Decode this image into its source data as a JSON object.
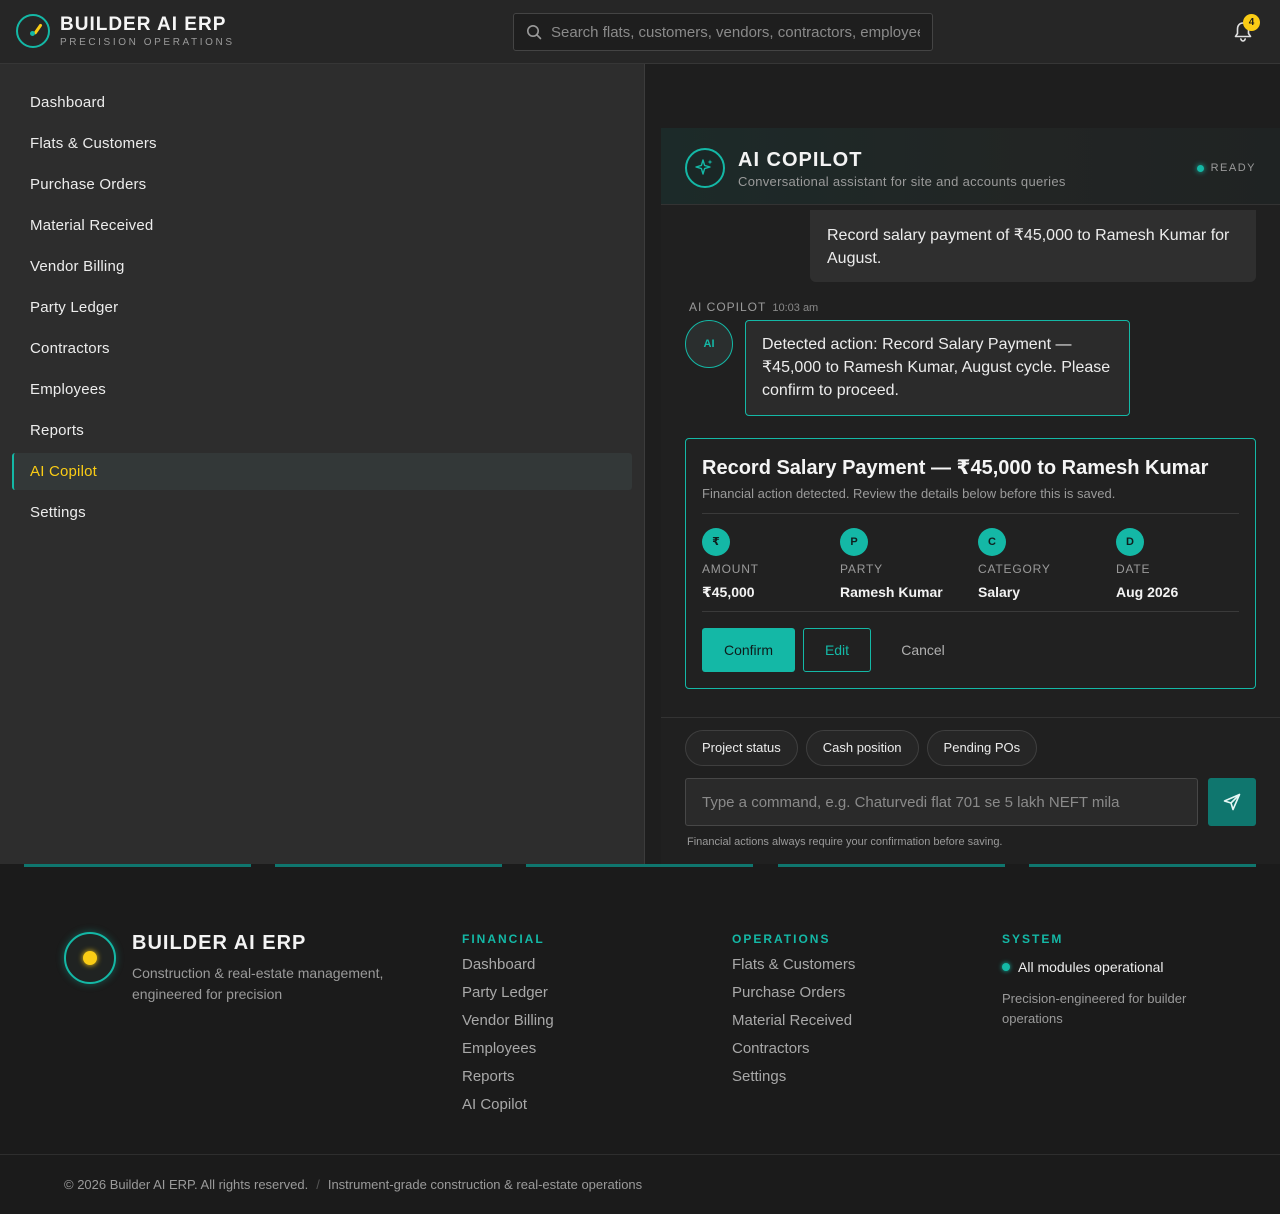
{
  "header": {
    "brand_title": "BUILDER AI ERP",
    "brand_subtitle": "PRECISION OPERATIONS",
    "search_placeholder": "Search flats, customers, vendors, contractors, employees",
    "notification_count": "4"
  },
  "sidebar": {
    "items": [
      {
        "label": "Dashboard"
      },
      {
        "label": "Flats & Customers"
      },
      {
        "label": "Purchase Orders"
      },
      {
        "label": "Material Received"
      },
      {
        "label": "Vendor Billing"
      },
      {
        "label": "Party Ledger"
      },
      {
        "label": "Contractors"
      },
      {
        "label": "Employees"
      },
      {
        "label": "Reports"
      },
      {
        "label": "AI Copilot",
        "active": true
      },
      {
        "label": "Settings"
      }
    ]
  },
  "copilot": {
    "title": "AI COPILOT",
    "subtitle": "Conversational assistant for site and accounts queries",
    "status": "READY",
    "user_message": "Record salary payment of ₹45,000 to Ramesh Kumar for August.",
    "ai_sender": "AI COPILOT",
    "ai_time": "10:03 am",
    "ai_avatar": "AI",
    "ai_message": "Detected action: Record Salary Payment — ₹45,000 to Ramesh Kumar, August cycle. Please confirm to proceed.",
    "action_card": {
      "title": "Record Salary Payment — ₹45,000 to Ramesh Kumar",
      "subtitle": "Financial action detected. Review the details below before this is saved.",
      "fields": [
        {
          "icon": "₹",
          "label": "AMOUNT",
          "value": "₹45,000"
        },
        {
          "icon": "P",
          "label": "PARTY",
          "value": "Ramesh Kumar"
        },
        {
          "icon": "C",
          "label": "CATEGORY",
          "value": "Salary"
        },
        {
          "icon": "D",
          "label": "DATE",
          "value": "Aug 2026"
        }
      ],
      "confirm_label": "Confirm",
      "edit_label": "Edit",
      "cancel_label": "Cancel"
    },
    "chips": [
      "Project status",
      "Cash position",
      "Pending POs"
    ],
    "input_placeholder": "Type a command, e.g. Chaturvedi flat 701 se 5 lakh NEFT mila",
    "hint": "Financial actions always require your confirmation before saving."
  },
  "footer": {
    "brand": "BUILDER AI ERP",
    "description": "Construction & real-estate management, engineered for precision",
    "financial": {
      "title": "FINANCIAL",
      "links": [
        "Dashboard",
        "Party Ledger",
        "Vendor Billing",
        "Employees",
        "Reports",
        "AI Copilot"
      ]
    },
    "operations": {
      "title": "OPERATIONS",
      "links": [
        "Flats & Customers",
        "Purchase Orders",
        "Material Received",
        "Contractors",
        "Settings"
      ]
    },
    "system": {
      "title": "SYSTEM",
      "status": "All modules operational",
      "description": "Precision-engineered for builder operations"
    },
    "copyright": "© 2026 Builder AI ERP. All rights reserved.",
    "separator": "/",
    "tagline": "Instrument-grade construction & real-estate operations"
  },
  "colors": {
    "accent": "#14b8a6",
    "highlight": "#facc15",
    "background": "#1b1b1b"
  }
}
